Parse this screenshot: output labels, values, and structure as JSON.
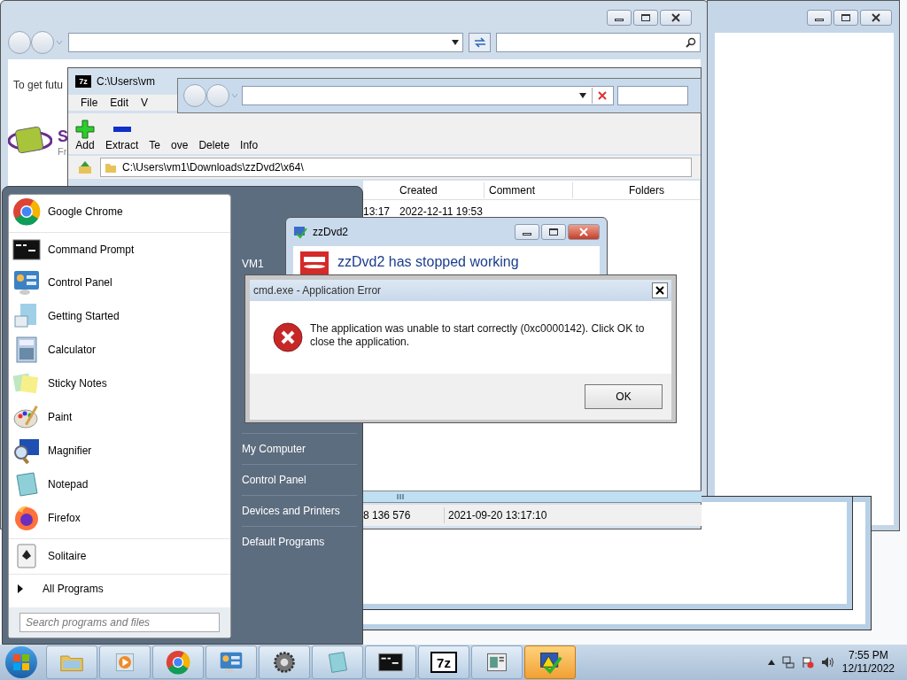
{
  "back_window": {
    "banner_text": "To get futu",
    "logo_title": "S",
    "logo_subtitle": "Fr"
  },
  "seven_zip": {
    "icon_label": "7z",
    "title": "C:\\Users\\vm",
    "menu": [
      "File",
      "Edit",
      "V"
    ],
    "toolbar": [
      {
        "label": "Add",
        "kind": "add"
      },
      {
        "label": "Extract",
        "kind": "extract"
      },
      {
        "label": "Te",
        "kind": "text"
      },
      {
        "label": "ove",
        "kind": "text"
      },
      {
        "label": "Delete",
        "kind": "text"
      },
      {
        "label": "Info",
        "kind": "text"
      }
    ],
    "path": "C:\\Users\\vm1\\Downloads\\zzDvd2\\x64\\",
    "columns": [
      "Created",
      "Comment",
      "Folders"
    ],
    "row": [
      "13:17",
      "2022-12-11 19:53"
    ],
    "status": [
      "8 136 576",
      "2021-09-20 13:17:10"
    ]
  },
  "start_menu": {
    "programs": [
      {
        "label": "Google Chrome",
        "kind": "chrome"
      },
      {
        "label": "Command Prompt",
        "kind": "cmd"
      },
      {
        "label": "Control Panel",
        "kind": "control"
      },
      {
        "label": "Getting Started",
        "kind": "doc"
      },
      {
        "label": "Calculator",
        "kind": "calc"
      },
      {
        "label": "Sticky Notes",
        "kind": "sticky"
      },
      {
        "label": "Paint",
        "kind": "paint"
      },
      {
        "label": "Magnifier",
        "kind": "magnifier"
      },
      {
        "label": "Notepad",
        "kind": "notepad"
      },
      {
        "label": "Firefox",
        "kind": "firefox"
      },
      {
        "label": "Solitaire",
        "kind": "cards"
      }
    ],
    "all_programs": "All Programs",
    "search": {
      "placeholder": "Search programs and files"
    },
    "user": "VM1",
    "places": [
      "My Computer",
      "Control Panel",
      "Devices and Printers",
      "Default Programs"
    ]
  },
  "zzdvd2": {
    "title": "zzDvd2",
    "message": "zzDvd2 has stopped working"
  },
  "error_dialog": {
    "title": "cmd.exe - Application Error",
    "message": "The application was unable to start correctly (0xc0000142). Click OK to close the application.",
    "button": "OK"
  },
  "taskbar": {
    "apps": [
      {
        "kind": "folder",
        "selected": false
      },
      {
        "kind": "media",
        "selected": false
      },
      {
        "kind": "chrome",
        "selected": false
      },
      {
        "kind": "control",
        "selected": false
      },
      {
        "kind": "gear",
        "selected": false
      },
      {
        "kind": "notepad",
        "selected": false
      },
      {
        "kind": "cmd",
        "selected": false
      },
      {
        "kind": "sevenzip",
        "label": "7z",
        "selected": false
      },
      {
        "kind": "window",
        "selected": false
      },
      {
        "kind": "warning",
        "selected": true
      }
    ],
    "time": "7:55 PM",
    "date": "12/11/2022"
  }
}
